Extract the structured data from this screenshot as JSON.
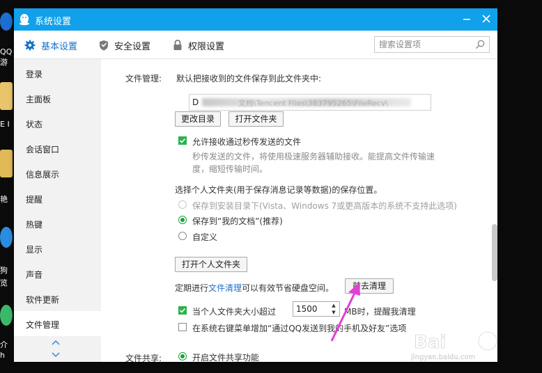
{
  "desktop": {
    "labels": [
      "QQ游",
      "E I",
      "艳",
      "狗",
      "览",
      "介",
      "h"
    ]
  },
  "window": {
    "title": "系统设置",
    "minimize_icon": "minus-icon",
    "close_icon": "close-icon"
  },
  "topnav": {
    "tabs": [
      {
        "label": "基本设置",
        "icon": "gear-icon",
        "active": true
      },
      {
        "label": "安全设置",
        "icon": "shield-icon",
        "active": false
      },
      {
        "label": "权限设置",
        "icon": "lock-icon",
        "active": false
      }
    ],
    "search_placeholder": "搜索设置项"
  },
  "sidebar": {
    "items": [
      "登录",
      "主面板",
      "状态",
      "会话窗口",
      "信息展示",
      "提醒",
      "热键",
      "显示",
      "声音",
      "软件更新",
      "文件管理"
    ],
    "active_index": 10
  },
  "file_mgmt": {
    "label": "文件管理:",
    "save_desc": "默认把接收到的文件保存到此文件夹中:",
    "path_prefix": "D",
    "path_visible": "文档\\Tencent Files\\383795265\\FileRecv\\",
    "change_dir_btn": "更改目录",
    "open_folder_btn": "打开文件夹",
    "allow_instant_label": "允许接收通过秒传发送的文件",
    "allow_instant_checked": true,
    "instant_desc_1": "秒传发送的文件，将使用极速服务器辅助接收。能提高文件传输速",
    "instant_desc_2": "度，缩短传输时间。",
    "personal_folder_desc": "选择个人文件夹(用于保存消息记录等数据)的保存位置。",
    "radio_install": "保存到安装目录下(Vista、Windows 7或更高版本的系统不支持此选项)",
    "radio_mydocs": "保存到“我的文档”(推荐)",
    "radio_custom": "自定义",
    "open_personal_btn": "打开个人文件夹",
    "cleanup_prefix": "定期进行",
    "cleanup_link": "文件清理",
    "cleanup_suffix": "可以有效节省硬盘空间。",
    "goto_cleanup_btn": "前去清理",
    "size_warn_prefix": "当个人文件夹大小超过",
    "size_value": "1500",
    "size_warn_suffix": "MB时，提醒我清理",
    "size_warn_checked": true,
    "context_menu_label": "在系统右键菜单增加“通过QQ发送到我的手机及好友”选项",
    "context_menu_checked": false
  },
  "file_share": {
    "label": "文件共享:",
    "enable_label": "开启文件共享功能"
  },
  "watermark": {
    "text": "Bai",
    "sub": "jingyan.baidu.com"
  },
  "colors": {
    "titlebar": "#11a0ea",
    "accent": "#1673c9",
    "checkbox": "#2bb24c",
    "arrow": "#e23fd8"
  }
}
